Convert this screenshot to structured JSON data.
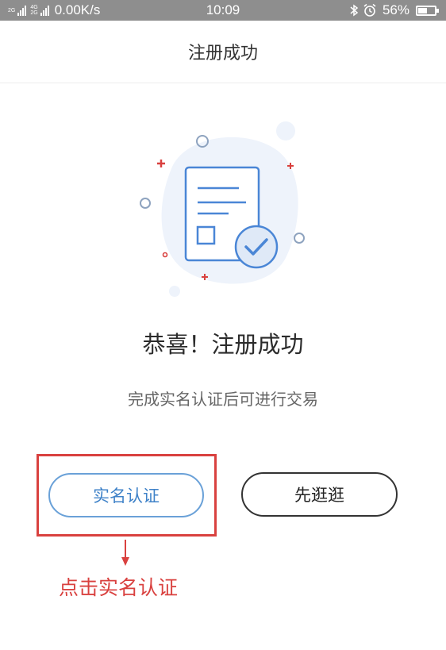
{
  "status_bar": {
    "network_a": "2G",
    "network_b": "4G",
    "network_c": "2G",
    "speed": "0.00K/s",
    "time": "10:09",
    "battery_percent": "56%",
    "battery_level": 0.56,
    "icons": [
      "signal-icon",
      "bluetooth-icon",
      "alarm-icon",
      "battery-icon"
    ]
  },
  "header": {
    "title": "注册成功"
  },
  "main": {
    "headline": "恭喜！注册成功",
    "message": "完成实名认证后可进行交易",
    "illustration_icon": "document-check-icon",
    "accent_color": "#4a86d6"
  },
  "actions": {
    "verify_label": "实名认证",
    "browse_label": "先逛逛"
  },
  "annotation": {
    "text": "点击实名认证",
    "color": "#d9413f"
  }
}
